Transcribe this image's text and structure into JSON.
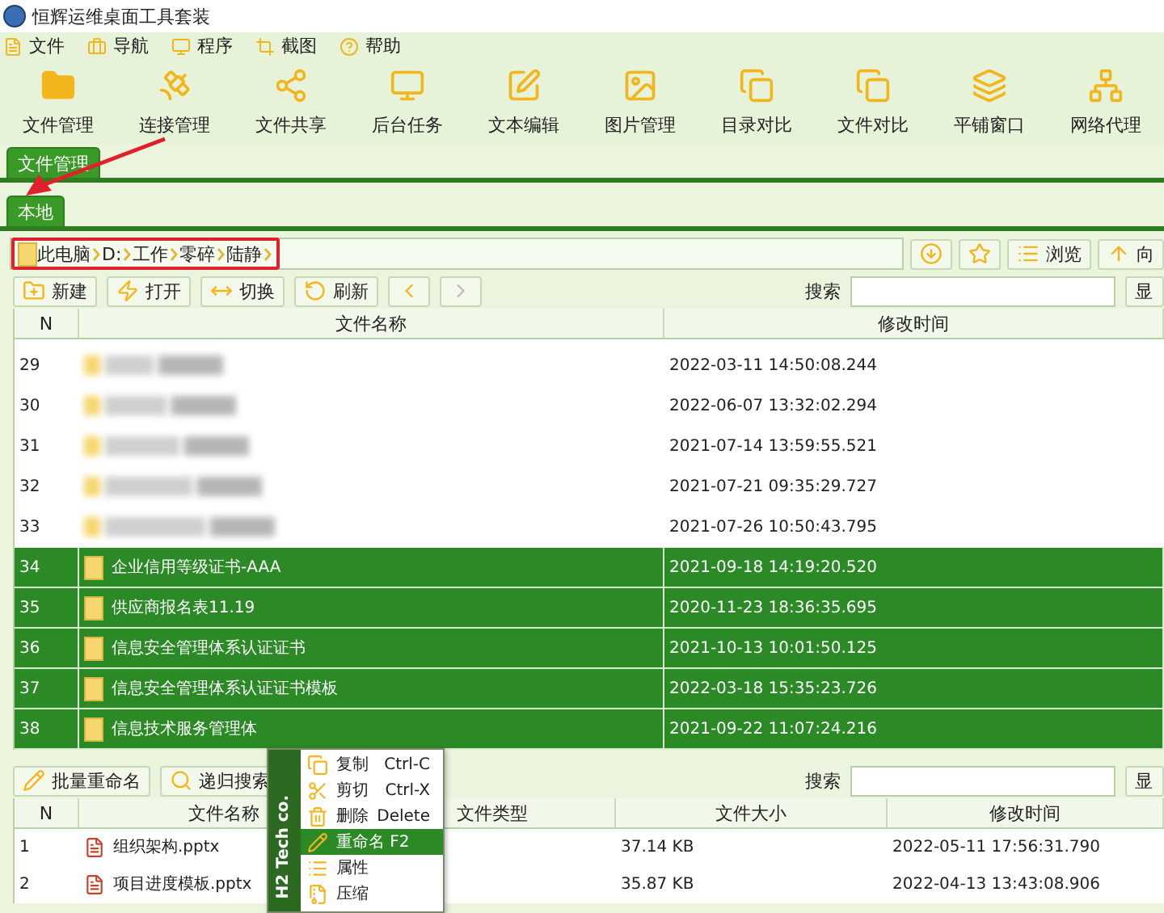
{
  "window": {
    "title": "恒辉运维桌面工具套装"
  },
  "menu": [
    {
      "label": "文件"
    },
    {
      "label": "导航"
    },
    {
      "label": "程序"
    },
    {
      "label": "截图"
    },
    {
      "label": "帮助"
    }
  ],
  "toolbar": [
    {
      "label": "文件管理"
    },
    {
      "label": "连接管理"
    },
    {
      "label": "文件共享"
    },
    {
      "label": "后台任务"
    },
    {
      "label": "文本编辑"
    },
    {
      "label": "图片管理"
    },
    {
      "label": "目录对比"
    },
    {
      "label": "文件对比"
    },
    {
      "label": "平铺窗口"
    },
    {
      "label": "网络代理"
    }
  ],
  "tabs": [
    {
      "label": "文件管理",
      "selected": true
    }
  ],
  "subtabs": [
    {
      "label": "本地",
      "selected": true
    }
  ],
  "breadcrumb": [
    "此电脑",
    "D:",
    "工作",
    "零碎",
    "陆静"
  ],
  "path_buttons": [
    {
      "kind": "download"
    },
    {
      "kind": "star"
    },
    {
      "kind": "browse",
      "label": "浏览"
    },
    {
      "kind": "up",
      "label": "向"
    }
  ],
  "file_toolbar": [
    {
      "kind": "new",
      "label": "新建"
    },
    {
      "kind": "open",
      "label": "打开"
    },
    {
      "kind": "switch",
      "label": "切换"
    },
    {
      "kind": "refresh",
      "label": "刷新"
    },
    {
      "kind": "back",
      "disabled": false
    },
    {
      "kind": "forward",
      "disabled": true
    }
  ],
  "search": {
    "label": "搜索",
    "button": "显"
  },
  "upper_table": {
    "columns": [
      "N",
      "文件名称",
      "修改时间"
    ],
    "rows": [
      {
        "n": "29",
        "blurred": true,
        "time": "2022-03-11 14:50:08.244",
        "selected": false
      },
      {
        "n": "30",
        "blurred": true,
        "time": "2022-06-07 13:32:02.294",
        "selected": false
      },
      {
        "n": "31",
        "blurred": true,
        "time": "2021-07-14 13:59:55.521",
        "selected": false
      },
      {
        "n": "32",
        "blurred": true,
        "time": "2021-07-21 09:35:29.727",
        "selected": false
      },
      {
        "n": "33",
        "blurred": true,
        "time": "2021-07-26 10:50:43.795",
        "selected": false
      },
      {
        "n": "34",
        "blurred": false,
        "name": "企业信用等级证书-AAA",
        "time": "2021-09-18 14:19:20.520",
        "selected": true
      },
      {
        "n": "35",
        "blurred": false,
        "name": "供应商报名表11.19",
        "time": "2020-11-23 18:36:35.695",
        "selected": true
      },
      {
        "n": "36",
        "blurred": false,
        "name": "信息安全管理体系认证证书",
        "time": "2021-10-13 10:01:50.125",
        "selected": true
      },
      {
        "n": "37",
        "blurred": false,
        "name": "信息安全管理体系认证证书模板",
        "time": "2022-03-18 15:35:23.726",
        "selected": true
      },
      {
        "n": "38",
        "blurred": false,
        "name": "信息技术服务管理体",
        "time": "2021-09-22 11:07:24.216",
        "selected": true
      }
    ]
  },
  "lower_toolbar": [
    {
      "kind": "rename",
      "label": "批量重命名"
    },
    {
      "kind": "search",
      "label": "递归搜索"
    }
  ],
  "lower_search": {
    "label": "搜索",
    "button": "显"
  },
  "lower_table": {
    "columns": [
      "N",
      "文件名称",
      "文件类型",
      "文件大小",
      "修改时间"
    ],
    "rows": [
      {
        "n": "1",
        "name": "组织架构.pptx",
        "size": "37.14 KB",
        "time": "2022-05-11 17:56:31.790"
      },
      {
        "n": "2",
        "name": "项目进度模板.pptx",
        "size": "35.87 KB",
        "time": "2022-04-13 13:43:08.906"
      }
    ]
  },
  "context_menu": {
    "brand": "H2 Tech co.",
    "items": [
      {
        "kind": "copy",
        "label": "复制",
        "shortcut": "Ctrl-C",
        "selected": false
      },
      {
        "kind": "cut",
        "label": "剪切",
        "shortcut": "Ctrl-X",
        "selected": false
      },
      {
        "kind": "delete",
        "label": "删除",
        "shortcut": "Delete",
        "selected": false
      },
      {
        "kind": "rename",
        "label": "重命名 F2",
        "selected": true
      },
      {
        "kind": "props",
        "label": "属性",
        "selected": false
      },
      {
        "kind": "zip",
        "label": "压缩",
        "selected": false
      }
    ]
  }
}
